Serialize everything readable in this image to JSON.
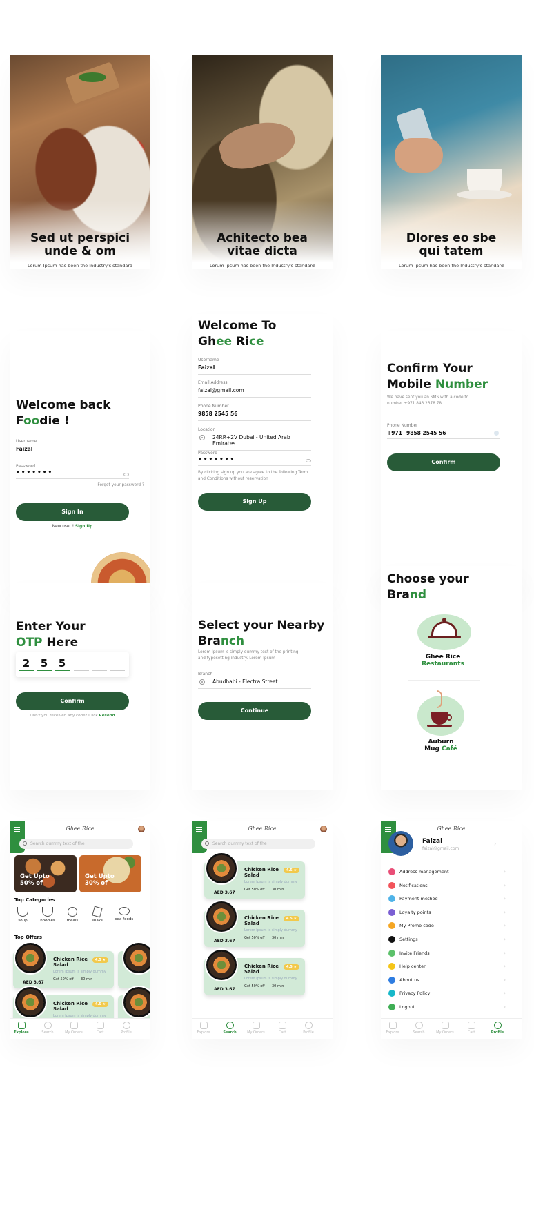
{
  "onboarding": [
    {
      "title_line1": "Sed ut perspici",
      "title_line2": "unde & om",
      "desc": "Lorum Ipsum has been the Industry's standard dummy text ever since the ever",
      "active_dot": 0
    },
    {
      "title_line1": "Achitecto bea",
      "title_line2": "vitae dicta",
      "desc": "Lorum Ipsum has been the Industry's standard dummy text ever since the ever",
      "active_dot": 1
    },
    {
      "title_line1": "Dlores eo sbe",
      "title_line2": "qui tatem",
      "desc": "Lorum Ipsum has been the Industry's standard dummy text ever since the ever",
      "active_dot": 2
    }
  ],
  "signin": {
    "title_1": "Welcome back",
    "title_2a": "F",
    "title_2b": "oo",
    "title_2c": "die !",
    "username_label": "Username",
    "username_value": "Faizal",
    "password_label": "Password",
    "password_value": "•••••••",
    "forgot": "Forgot your password ?",
    "button": "Sign In",
    "new_user": "New user ! ",
    "signup_link": "Sign Up"
  },
  "signup": {
    "title_1": "Welcome To",
    "title_2a": "Gh",
    "title_2b": "ee",
    "title_2c": " Ri",
    "title_2d": "ce",
    "username_label": "Username",
    "username_value": "Faizal",
    "email_label": "Email Address",
    "email_value": "faizal@gmail.com",
    "phone_label": "Phone Number",
    "phone_value": "9858 2545 56",
    "location_label": "Location",
    "location_value": "24RR+2V Dubai - United Arab Emirates",
    "password_label": "Password",
    "password_value": "•••••••",
    "terms": "By clicking sign up you are agree to the following Term and Conditions without reservation",
    "button": "Sign Up"
  },
  "confirm_mobile": {
    "title_1": "Confirm Your",
    "title_2a": "Mobile ",
    "title_2b": "Number",
    "sub": "We have sent you an SMS with a code to number +971 843 2378 78",
    "phone_label": "Phone Number",
    "code": "+971",
    "phone": "9858 2545 56",
    "button": "Confirm"
  },
  "otp": {
    "title_1": "Enter Your",
    "title_2a": "OTP",
    "title_2b": " Here",
    "digits": [
      "2",
      "5",
      "5",
      "",
      "",
      ""
    ],
    "button": "Confirm",
    "note": "Don't you received any code? Click ",
    "resend": "Resend"
  },
  "branch": {
    "title_1": "Select your Nearby",
    "title_2a": "Bra",
    "title_2b": "nch",
    "sub": "Lorem Ipsum is simply dummy text of the printing and typesetting industry. Lorem Ipsum",
    "branch_label": "Branch",
    "branch_value": "Abudhabi - Electra Street",
    "button": "Continue"
  },
  "brand": {
    "title_1": "Choose your",
    "title_2a": "Bra",
    "title_2b": "nd",
    "brand1_line1": "Ghee Rice",
    "brand1_line2": "Restaurants",
    "brand2_line1": "Auburn",
    "brand2_line2a": "Mug ",
    "brand2_line2b": "Café"
  },
  "app": {
    "logo": "Ghee Rice",
    "search_placeholder": "Search dummy text of the",
    "offer_text_1": "Get Upto",
    "offer_pct_1": "50% of",
    "offer_text_2": "Get Upto",
    "offer_pct_2": "30% of",
    "top_categories": "Top Categories",
    "categories": [
      "soup",
      "noodles",
      "meals",
      "snaks",
      "sea foods"
    ],
    "top_offers": "Top Offers",
    "food_name": "Chicken Rice Salad",
    "food_desc": "Lorem Ipsum is simply dummy",
    "rating": "4.5 ★",
    "off": "Get 50% off",
    "time": "30 min",
    "price": "AED 3.67",
    "nav": [
      "Explore",
      "Search",
      "My Orders",
      "Cart",
      "Profile"
    ]
  },
  "profile": {
    "name": "Faizal",
    "email": "faizal@gmail.com",
    "items": [
      {
        "label": "Address management",
        "color": "#e94e77"
      },
      {
        "label": "Notifications",
        "color": "#f2545b"
      },
      {
        "label": "Payment method",
        "color": "#4fb3e8"
      },
      {
        "label": "Loyalty points",
        "color": "#7b5fd3"
      },
      {
        "label": "My Promo code",
        "color": "#f5a623"
      },
      {
        "label": "Settings",
        "color": "#111111"
      },
      {
        "label": "Invite Friends",
        "color": "#5cc16b"
      },
      {
        "label": "Help center",
        "color": "#f5c518"
      },
      {
        "label": "About us",
        "color": "#2f7de1"
      },
      {
        "label": "Privacy Policy",
        "color": "#17b8c9"
      },
      {
        "label": "Logout",
        "color": "#3fae55"
      }
    ]
  }
}
